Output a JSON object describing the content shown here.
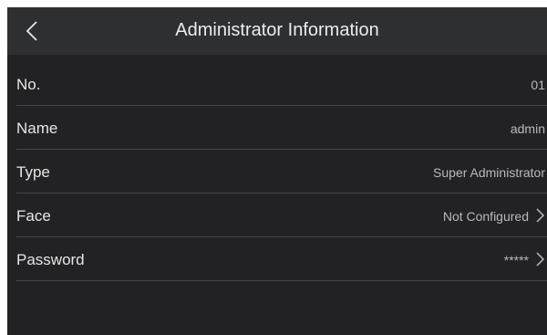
{
  "header": {
    "title": "Administrator Information",
    "back_icon": "chevron-left-icon"
  },
  "rows": [
    {
      "label": "No.",
      "value": "01"
    },
    {
      "label": "Name",
      "value": "admin"
    },
    {
      "label": "Type",
      "value": "Super Administrator"
    },
    {
      "label": "Face",
      "value": "Not Configured"
    },
    {
      "label": "Password",
      "value": "*****"
    }
  ],
  "colors": {
    "background": "#222224",
    "header": "#2e2f31",
    "text": "#e6e6e6",
    "value_text": "#b9b9b9",
    "divider": "#45464a"
  }
}
